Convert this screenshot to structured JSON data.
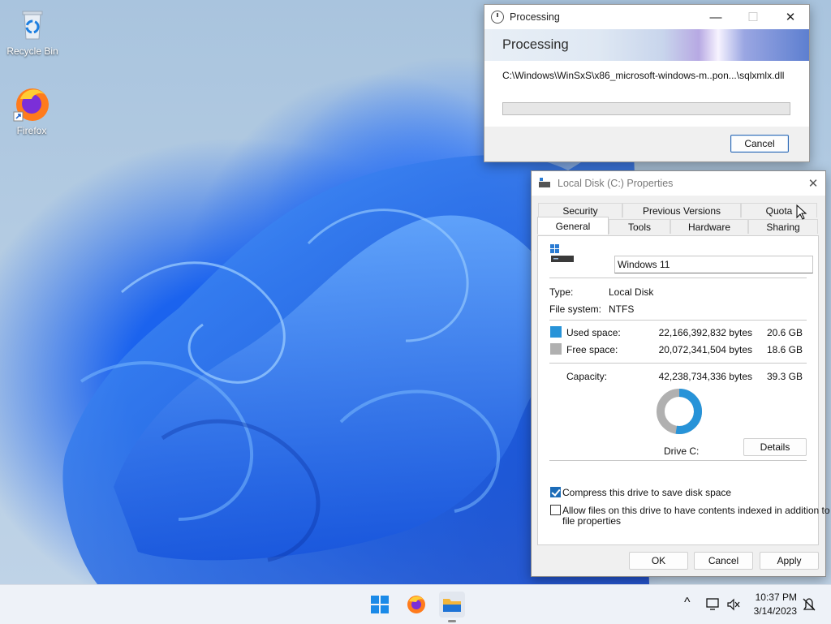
{
  "desktop": {
    "icons": [
      {
        "label": "Recycle Bin",
        "icon": "recycle-bin-icon"
      },
      {
        "label": "Firefox",
        "icon": "firefox-icon"
      }
    ]
  },
  "processing": {
    "window_title": "Processing",
    "banner_title": "Processing",
    "current_path": "C:\\Windows\\WinSxS\\x86_microsoft-windows-m..pon...\\sqlxmlx.dll",
    "progress_fraction": 0,
    "cancel_label": "Cancel",
    "caption": {
      "minimize": "—",
      "maximize": "☐",
      "close": "✕"
    }
  },
  "properties": {
    "window_title": "Local Disk (C:) Properties",
    "close_glyph": "✕",
    "tabs_back": [
      "Security",
      "Previous Versions",
      "Quota"
    ],
    "tabs_front": [
      "General",
      "Tools",
      "Hardware",
      "Sharing"
    ],
    "active_tab": "General",
    "volume_name": "Windows 11",
    "type_label": "Type:",
    "type_value": "Local Disk",
    "fs_label": "File system:",
    "fs_value": "NTFS",
    "used": {
      "label": "Used space:",
      "bytes": "22,166,392,832 bytes",
      "size": "20.6 GB",
      "color": "#2793d8"
    },
    "free": {
      "label": "Free space:",
      "bytes": "20,072,341,504 bytes",
      "size": "18.6 GB",
      "color": "#b0b0b0"
    },
    "capacity": {
      "label": "Capacity:",
      "bytes": "42,238,734,336 bytes",
      "size": "39.3 GB"
    },
    "drive_label": "Drive C:",
    "details_label": "Details",
    "compress": {
      "label": "Compress this drive to save disk space",
      "checked": true
    },
    "index": {
      "line1": "Allow files on this drive to have contents indexed in addition to",
      "line2": "file properties",
      "checked": false
    },
    "buttons": {
      "ok": "OK",
      "cancel": "Cancel",
      "apply": "Apply"
    }
  },
  "taskbar": {
    "items": [
      "start-icon",
      "firefox-icon",
      "file-explorer-icon"
    ],
    "tray": {
      "time": "10:37 PM",
      "date": "3/14/2023",
      "chevron": "^"
    }
  }
}
